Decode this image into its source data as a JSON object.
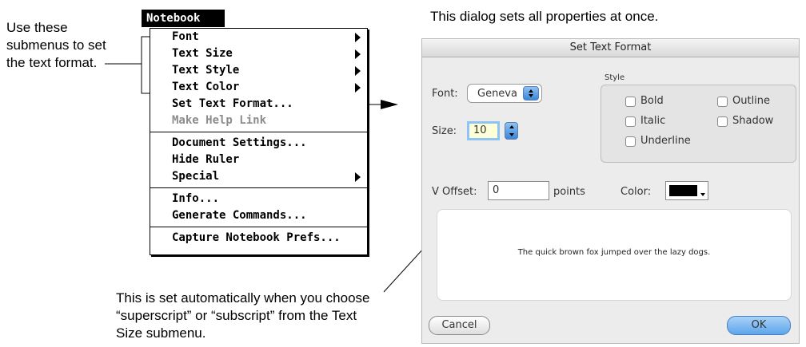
{
  "annotations": {
    "left": "Use these submenus to set the text format.",
    "top": "This dialog sets all properties at once.",
    "bottom": "This is set automatically when you choose “superscript” or “subscript” from the Text Size submenu."
  },
  "menu": {
    "title": "Notebook",
    "items": [
      {
        "label": "Font",
        "submenu": true,
        "enabled": true
      },
      {
        "label": "Text Size",
        "submenu": true,
        "enabled": true
      },
      {
        "label": "Text Style",
        "submenu": true,
        "enabled": true
      },
      {
        "label": "Text Color",
        "submenu": true,
        "enabled": true
      },
      {
        "label": "Set Text Format...",
        "submenu": false,
        "enabled": true
      },
      {
        "label": "Make Help Link",
        "submenu": false,
        "enabled": false
      },
      {
        "label": "Document Settings...",
        "submenu": false,
        "enabled": true
      },
      {
        "label": "Hide Ruler",
        "submenu": false,
        "enabled": true
      },
      {
        "label": "Special",
        "submenu": true,
        "enabled": true
      },
      {
        "label": "Info...",
        "submenu": false,
        "enabled": true
      },
      {
        "label": "Generate Commands...",
        "submenu": false,
        "enabled": true
      },
      {
        "label": "Capture Notebook Prefs...",
        "submenu": false,
        "enabled": true
      }
    ]
  },
  "dialog": {
    "title": "Set Text Format",
    "font_label": "Font:",
    "font_value": "Geneva",
    "size_label": "Size:",
    "size_value": "10",
    "style_group_label": "Style",
    "style": {
      "bold": "Bold",
      "italic": "Italic",
      "underline": "Underline",
      "outline": "Outline",
      "shadow": "Shadow"
    },
    "voffset_label": "V Offset:",
    "voffset_value": "0",
    "voffset_unit": "points",
    "color_label": "Color:",
    "color_value": "#000000",
    "preview_text": "The quick brown fox jumped over the lazy dogs.",
    "cancel_label": "Cancel",
    "ok_label": "OK",
    "accent_color": "#5ca5ec"
  }
}
